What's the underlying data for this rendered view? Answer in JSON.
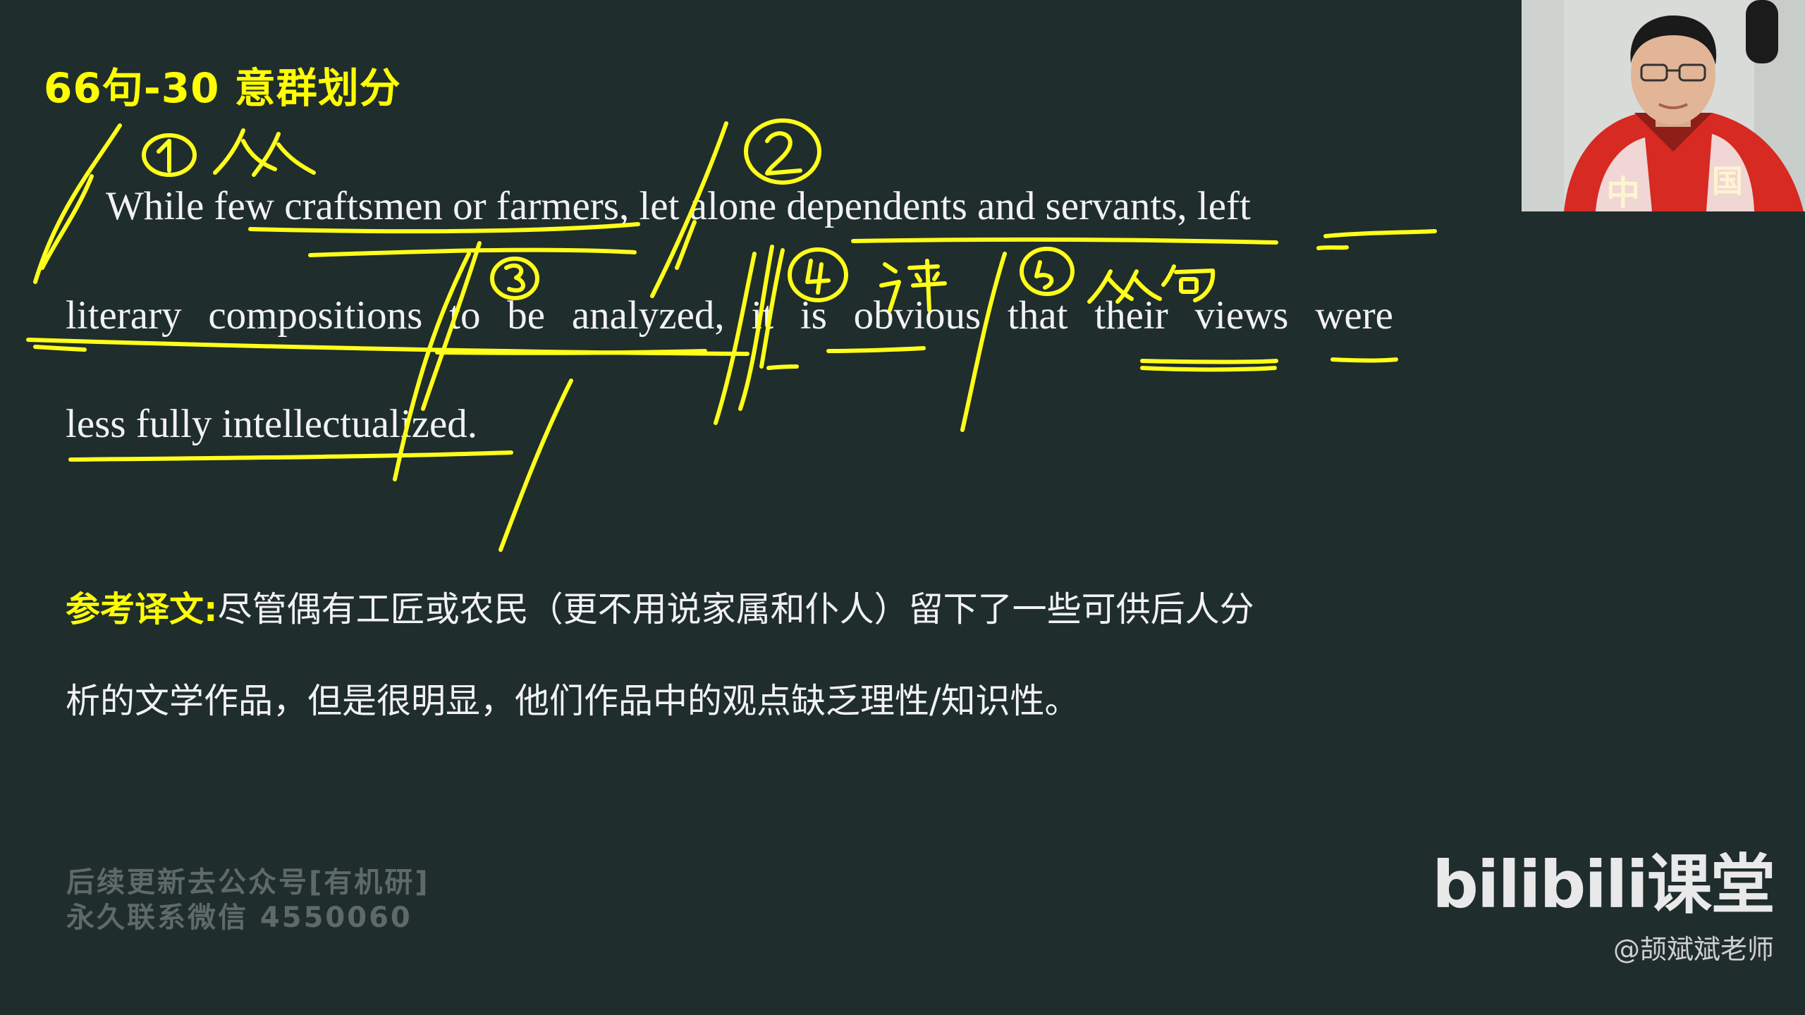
{
  "slide": {
    "title": "66句-30 意群划分",
    "english_lines": [
      "While few craftsmen or farmers, let alone dependents and servants, left",
      "literary compositions to be analyzed, it is obvious that their views were",
      "less fully intellectualized."
    ],
    "reference_label": "参考译文:",
    "chinese_lines": [
      "尽管偶有工匠或农民（更不用说家属和仆人）留下了一些可供后人分",
      "析的文学作品，但是很明显，他们作品中的观点缺乏理性/知识性。"
    ]
  },
  "watermark": {
    "line1": "后续更新去公众号[有机研]",
    "line2": "永久联系微信 4550060"
  },
  "brand": {
    "logo": "bilibili课堂",
    "handle": "@颉斌斌老师"
  },
  "annotations": {
    "marks": [
      "①",
      "从",
      "②",
      "③",
      "④",
      "评",
      "⑤",
      "从句"
    ],
    "ink_color": "#ffff1a"
  },
  "colors": {
    "background": "#1f2d2c",
    "title": "#ffff00",
    "text": "#f2f2f2",
    "watermark": "#5e6a68"
  }
}
